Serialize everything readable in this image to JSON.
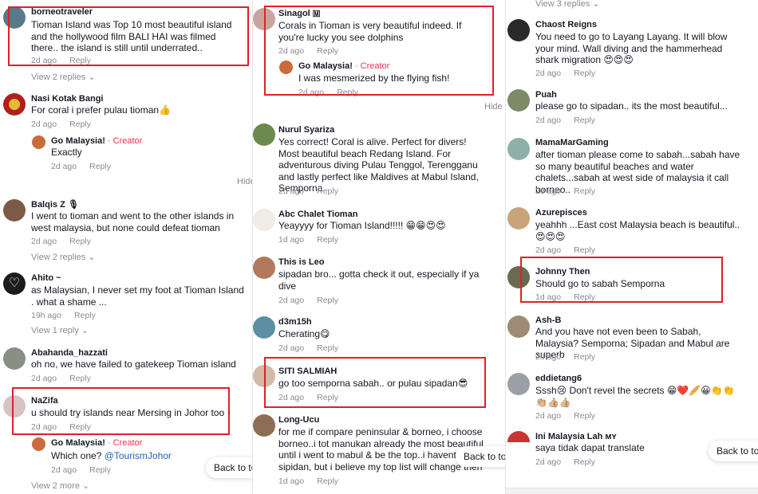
{
  "common": {
    "reply": "Reply",
    "hide": "Hide",
    "back_to_top": "Back to top",
    "creator": "· Creator"
  },
  "panel1": {
    "c1": {
      "name": "borneotraveler",
      "text": "Tioman Island was Top 10 most beautiful island and the hollywood film BALI HAI was filmed there.. the island is still until underrated..",
      "time": "2d ago",
      "replies": "View 2 replies"
    },
    "c2": {
      "name": "Nasi Kotak Bangi",
      "text": "For coral i prefer pulau tioman👍",
      "time": "2d ago"
    },
    "c2r": {
      "name": "Go Malaysia!",
      "text": "Exactly",
      "time": "2d ago"
    },
    "c3": {
      "name": "Balqis Z 🎙",
      "text": "I went to tioman and went to the other islands in west malaysia, but none could defeat tioman",
      "time": "2d ago",
      "replies": "View 2 replies"
    },
    "c4": {
      "name": "Ahito ~",
      "text": "as Malaysian, I never set my foot at Tioman Island . what a shame ...",
      "time": "19h ago",
      "replies": "View 1 reply"
    },
    "c5": {
      "name": "Abahanda_hazzati",
      "text": "oh no, we have failed to gatekeep Tioman island",
      "time": "2d ago"
    },
    "c6": {
      "name": "NaZifa",
      "text": "u should try islands near Mersing in Johor too",
      "time": "2d ago"
    },
    "c6r": {
      "name": "Go Malaysia!",
      "text": "Which one? ",
      "mention": "@TourismJohor",
      "time": "2d ago"
    },
    "more": "View 2 more"
  },
  "panel2": {
    "c1": {
      "name": "Sinagol 🇲",
      "text": "Corals in Tioman is very beautiful indeed. If you're lucky you see dolphins",
      "time": "2d ago"
    },
    "c1r": {
      "name": "Go Malaysia!",
      "text": "I was mesmerized by the flying fish!",
      "time": "2d ago"
    },
    "c2": {
      "name": "Nurul Syariza",
      "text": "Yes correct! Coral is alive. Perfect for divers! Most beautiful beach Redang Island. For adventurous diving Pulau Tenggol, Terengganu and lastly perfect like Maldives at Mabul Island, Semporna",
      "time": "2d ago"
    },
    "c3": {
      "name": "Abc Chalet Tioman",
      "text": "Yeayyyy for Tioman Island!!!!! 😁😁😍😍",
      "time": "1d ago"
    },
    "c4": {
      "name": "This is Leo",
      "text": "sipadan bro... gotta check it out, especially if ya dive",
      "time": "2d ago"
    },
    "c5": {
      "name": "d3m15h",
      "text": "Cherating😋",
      "time": "2d ago"
    },
    "c6": {
      "name": "SITI SALMIAH",
      "text": "go too semporna sabah.. or pulau sipadan😎",
      "time": "2d ago"
    },
    "c7": {
      "name": "Long-Ucu",
      "text": "for me if compare peninsular & borneo, i choose borneo..i tot manukan already the most beautiful until i went to mabul & be the top..i havent go sipidan, but i believe my top list will change then",
      "time": "1d ago"
    }
  },
  "panel3": {
    "top": "View 3 replies",
    "c1": {
      "name": "Chaost Reigns",
      "text": "You need to go to Layang Layang. It will blow your mind. Wall diving and the hammerhead shark migration 😍😍😍",
      "time": "2d ago"
    },
    "c2": {
      "name": "Puah",
      "text": "please go to sipadan.. its the most beautiful...",
      "time": "2d ago"
    },
    "c3": {
      "name": "MamaMarGaming",
      "text": "after tioman please come to sabah...sabah have so many beautiful beaches and water chalets...sabah at west side of malaysia it call borneo..",
      "time": "2d ago"
    },
    "c4": {
      "name": "Azurepisces",
      "text": "yeahhh ...East cost Malaysia beach is beautiful..😍😍😍",
      "time": "2d ago"
    },
    "c5": {
      "name": "Johnny Then",
      "text": "Should go to sabah Semporna",
      "time": "1d ago"
    },
    "c6": {
      "name": "Ash-B",
      "text": "And you have not even been to Sabah, Malaysia? Semporna; Sipadan and Mabul are superb",
      "time": "2d ago"
    },
    "c7": {
      "name": "eddietang6",
      "text": "Sssh😢 Don't revel the secrets 😁❤️🥖😀👏👏👏🏼👍🏼👍🏼",
      "time": "2d ago"
    },
    "c8": {
      "name": "Ini Malaysia Lah ᴍʏ",
      "text": "saya tidak dapat translate",
      "time": "2d ago"
    }
  },
  "colors": {
    "highlight": "#e0202a",
    "creator": "#fe2c55",
    "mention": "#2a60b8"
  }
}
